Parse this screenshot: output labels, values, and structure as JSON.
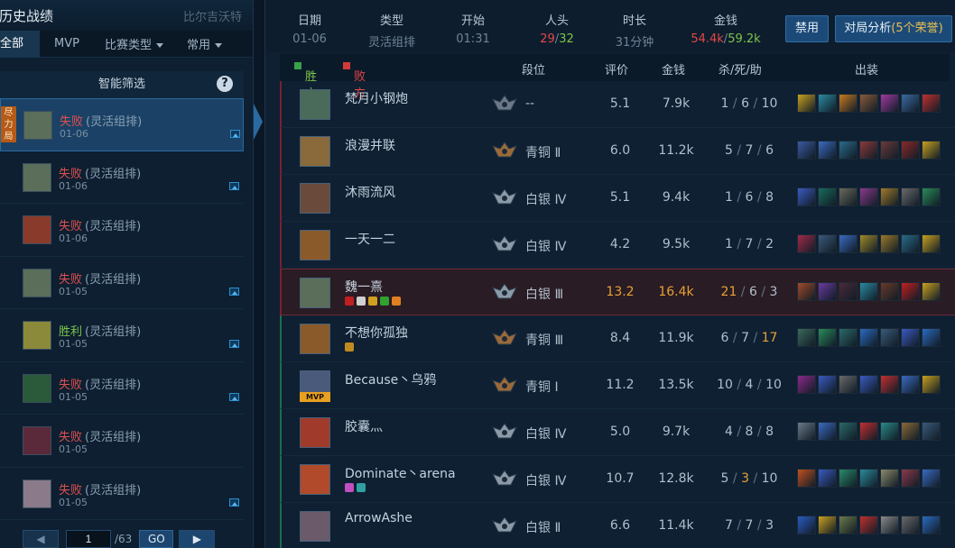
{
  "left": {
    "title": "历史战绩",
    "server": "比尔吉沃特",
    "tabs": [
      {
        "label": "全部",
        "dd": false
      },
      {
        "label": "MVP",
        "dd": false
      },
      {
        "label": "比赛类型",
        "dd": true
      },
      {
        "label": "常用",
        "dd": true
      }
    ],
    "filter": "智能筛选",
    "help": "?",
    "items": [
      {
        "result": "失败",
        "mode": "(灵活组排)",
        "date": "01-06",
        "win": false,
        "selected": true,
        "tag": "尽力局",
        "pic": true,
        "color": "#5a6e5a"
      },
      {
        "result": "失败",
        "mode": "(灵活组排)",
        "date": "01-06",
        "win": false,
        "pic": true,
        "color": "#5a6e5a"
      },
      {
        "result": "失败",
        "mode": "(灵活组排)",
        "date": "01-06",
        "win": false,
        "pic": false,
        "color": "#8a3a2a"
      },
      {
        "result": "失败",
        "mode": "(灵活组排)",
        "date": "01-05",
        "win": false,
        "pic": true,
        "color": "#5a6e5a"
      },
      {
        "result": "胜利",
        "mode": "(灵活组排)",
        "date": "01-05",
        "win": true,
        "pic": true,
        "color": "#8a8a3a"
      },
      {
        "result": "失败",
        "mode": "(灵活组排)",
        "date": "01-05",
        "win": false,
        "pic": true,
        "color": "#2a5a3a"
      },
      {
        "result": "失败",
        "mode": "(灵活组排)",
        "date": "01-05",
        "win": false,
        "pic": false,
        "color": "#5a2a3a"
      },
      {
        "result": "失败",
        "mode": "(灵活组排)",
        "date": "01-05",
        "win": false,
        "pic": true,
        "color": "#8a7a8a"
      }
    ],
    "pager": {
      "page": "1",
      "total": "/63",
      "go": "GO"
    }
  },
  "summary": {
    "date_h": "日期",
    "date": "01-06",
    "type_h": "类型",
    "type": "灵活组排",
    "start_h": "开始",
    "start": "01:31",
    "kills_h": "人头",
    "kills_a": "29",
    "kills_sep": "/",
    "kills_b": "32",
    "dur_h": "时长",
    "dur": "31分钟",
    "gold_h": "金钱",
    "gold_a": "54.4k",
    "gold_sep": "/",
    "gold_b": "59.2k",
    "ban": "禁用",
    "analysis": "对局分析",
    "honors": "(5个荣誉)"
  },
  "headers": {
    "win": "胜方",
    "lose": "败方",
    "rank": "段位",
    "score": "评价",
    "gold": "金钱",
    "kda": "杀/死/助",
    "items": "出装"
  },
  "rows": [
    {
      "name": "梵月小钢炮",
      "rank": "--",
      "score": "5.1",
      "gold": "7.9k",
      "k": "1",
      "d": "6",
      "a": "10",
      "team": "l",
      "hero": "#4a6a5a",
      "rc": "#6a7a8a",
      "items": [
        "#c8a020",
        "#2a8aa0",
        "#c87a20",
        "#8a5a3a",
        "#a03aa0",
        "#3a6aa0",
        "#c03030"
      ]
    },
    {
      "name": "浪漫并联",
      "rank": "青铜 Ⅱ",
      "score": "6.0",
      "gold": "11.2k",
      "k": "5",
      "d": "7",
      "a": "6",
      "team": "l",
      "hero": "#8a6a3a",
      "rc": "#9a6a3a",
      "items": [
        "#3a5aa0",
        "#3a6ac0",
        "#2a6a8a",
        "#8a3a3a",
        "#6a3a3a",
        "#8a2a2a",
        "#c8a020"
      ]
    },
    {
      "name": "沐雨流风",
      "rank": "白银 Ⅳ",
      "score": "5.1",
      "gold": "9.4k",
      "k": "1",
      "d": "6",
      "a": "8",
      "team": "l",
      "hero": "#6a4a3a",
      "rc": "#8a9aa8",
      "items": [
        "#3a5ac0",
        "#1a6a5a",
        "#6a6a5a",
        "#8a3a8a",
        "#a07a2a",
        "#6a6a6a",
        "#2a8a5a"
      ]
    },
    {
      "name": "一天一二",
      "rank": "白银 Ⅳ",
      "score": "4.2",
      "gold": "9.5k",
      "k": "1",
      "d": "7",
      "a": "2",
      "team": "l",
      "hero": "#8a5a2a",
      "rc": "#8a9aa8",
      "items": [
        "#a02a4a",
        "#3a5a7a",
        "#3a6ac0",
        "#a08a2a",
        "#9a7a2a",
        "#2a6a8a",
        "#c8a020"
      ]
    },
    {
      "name": "魏一熹",
      "rank": "白银 Ⅲ",
      "score": "13.2",
      "gold": "16.4k",
      "k": "21",
      "d": "6",
      "a": "3",
      "team": "l",
      "hl": true,
      "hero": "#5a6e5a",
      "rc": "#8a9aa8",
      "badges": [
        "#c02020",
        "#d0d0d0",
        "#d0a020",
        "#30a030",
        "#e08020"
      ],
      "items": [
        "#a04a2a",
        "#6a3aa0",
        "#4a2a3a",
        "#2a8aa0",
        "#6a3a2a",
        "#c02020",
        "#c8a020"
      ]
    },
    {
      "name": "不想你孤独",
      "rank": "青铜 Ⅲ",
      "score": "8.4",
      "gold": "11.9k",
      "k": "6",
      "d": "7",
      "a": "17",
      "team": "w",
      "hero": "#8a5a2a",
      "rc": "#9a6a3a",
      "badges": [
        "#c08a20"
      ],
      "items": [
        "#3a6a5a",
        "#2a8a5a",
        "#2a6a6a",
        "#2a6ac0",
        "#3a5a7a",
        "#3a5ac0",
        "#2a6ac0"
      ]
    },
    {
      "name": "Because丶乌鸦",
      "rank": "青铜 Ⅰ",
      "score": "11.2",
      "gold": "13.5k",
      "k": "10",
      "d": "4",
      "a": "10",
      "team": "w",
      "mvp": true,
      "hero": "#4a5a7a",
      "rc": "#9a6a3a",
      "items": [
        "#8a2a8a",
        "#3a5ac0",
        "#6a6a6a",
        "#3a5ac0",
        "#c03030",
        "#3a6ac0",
        "#c8a020"
      ]
    },
    {
      "name": "胶囊灬",
      "rank": "白银 Ⅳ",
      "score": "5.0",
      "gold": "9.7k",
      "k": "4",
      "d": "8",
      "a": "8",
      "team": "w",
      "hero": "#a03a2a",
      "rc": "#8a9aa8",
      "items": [
        "#6a7a8a",
        "#3a6ac0",
        "#2a6a6a",
        "#c03030",
        "#2a8a8a",
        "#8a6a3a",
        "#3a5a7a"
      ]
    },
    {
      "name": "Dominate丶arena",
      "rank": "白银 Ⅳ",
      "score": "10.7",
      "gold": "12.8k",
      "k": "5",
      "d": "3",
      "a": "10",
      "team": "w",
      "hero": "#b04a2a",
      "rc": "#8a9aa8",
      "badges": [
        "#c050c0",
        "#30a0a0"
      ],
      "items": [
        "#c05020",
        "#3a5ac0",
        "#2a8a6a",
        "#2a8a9a",
        "#8a8a6a",
        "#8a3a4a",
        "#3a6ac0"
      ]
    },
    {
      "name": "ArrowAshe",
      "rank": "白银 Ⅱ",
      "score": "6.6",
      "gold": "11.4k",
      "k": "7",
      "d": "7",
      "a": "3",
      "team": "w",
      "hero": "#6a5a6a",
      "rc": "#8a9aa8",
      "items": [
        "#2a5ac0",
        "#c8a020",
        "#6a7a4a",
        "#c03030",
        "#8a8a8a",
        "#6a6a6a",
        "#2a6ac0"
      ]
    }
  ]
}
